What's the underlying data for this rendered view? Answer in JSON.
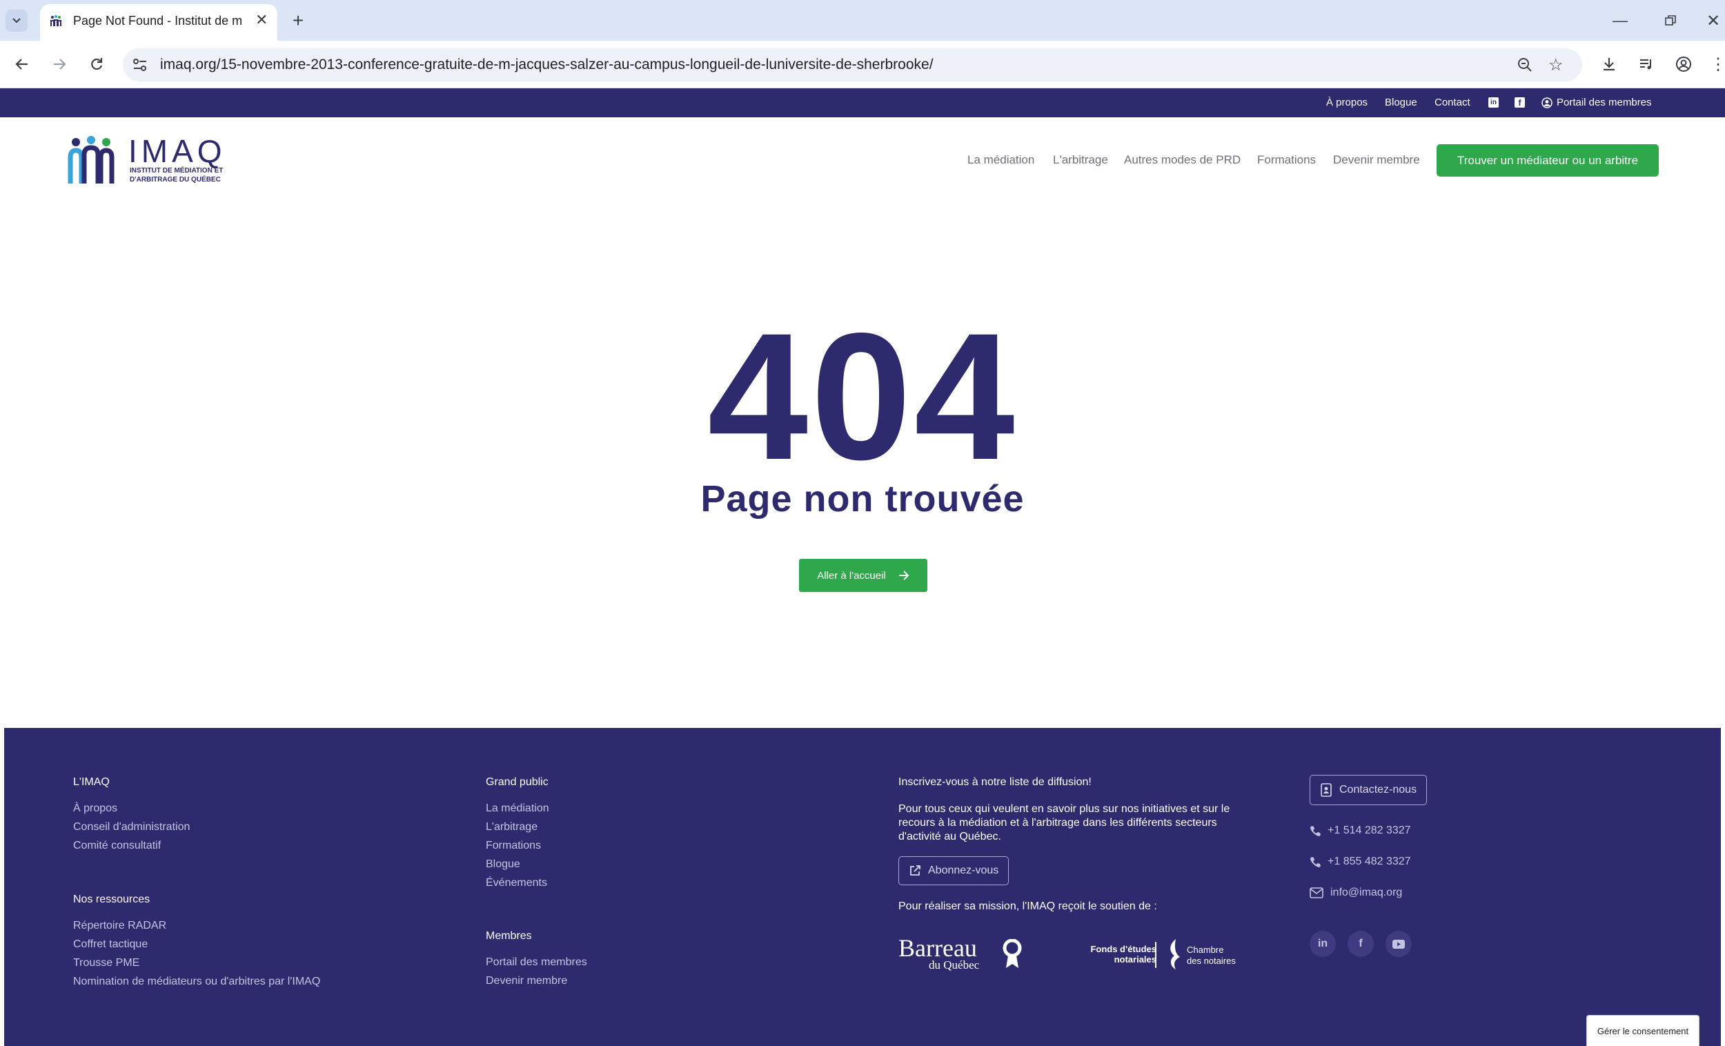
{
  "browser": {
    "tab_title": "Page Not Found - Institut de m",
    "url": "imaq.org/15-novembre-2013-conference-gratuite-de-m-jacques-salzer-au-campus-longueil-de-luniversite-de-sherbrooke/"
  },
  "topbar": {
    "links": [
      "À propos",
      "Blogue",
      "Contact"
    ],
    "members_portal": "Portail des membres"
  },
  "header": {
    "logo_text": "IMAQ",
    "logo_sub_line1": "INSTITUT DE MÉDIATION ET",
    "logo_sub_line2": "D'ARBITRAGE DU QUÉBEC",
    "nav": [
      "La médiation",
      "L'arbitrage",
      "Autres modes de PRD",
      "Formations",
      "Devenir membre"
    ],
    "cta": "Trouver un médiateur ou un arbitre"
  },
  "main": {
    "code": "404",
    "title": "Page non trouvée",
    "home_button": "Aller à l'accueil"
  },
  "footer": {
    "col1": {
      "heading": "L'IMAQ",
      "links": [
        "À propos",
        "Conseil d'administration",
        "Comité consultatif"
      ],
      "heading2": "Nos ressources",
      "links2": [
        "Répertoire RADAR",
        "Coffret tactique",
        "Trousse PME",
        "Nomination de médiateurs ou d'arbitres par l'IMAQ"
      ]
    },
    "col2": {
      "heading": "Grand public",
      "links": [
        "La médiation",
        "L'arbitrage",
        "Formations",
        "Blogue",
        "Événements"
      ],
      "heading2": "Membres",
      "links2": [
        "Portail des membres",
        "Devenir membre"
      ]
    },
    "col3": {
      "heading": "Inscrivez-vous à notre liste de diffusion!",
      "text": "Pour tous ceux qui veulent en savoir plus sur nos initiatives et sur le recours à la médiation et à l'arbitrage dans les différents secteurs d'activité au Québec.",
      "subscribe": "Abonnez-vous",
      "support": "Pour réaliser sa mission, l'IMAQ reçoit le soutien de :",
      "sponsor1": "Barreau",
      "sponsor1_sub": "du Québec",
      "sponsor2_line1": "Fonds d'études",
      "sponsor2_line2": "notariales",
      "sponsor3_line1": "Chambre",
      "sponsor3_line2": "des notaires"
    },
    "col4": {
      "contact_button": "Contactez-nous",
      "phone1": "+1 514 282 3327",
      "phone2": "+1 855 482 3327",
      "email": "info@imaq.org",
      "social": [
        "linkedin-icon",
        "facebook-icon",
        "youtube-icon"
      ]
    }
  },
  "consent": "Gérer le consentement",
  "colors": {
    "brand": "#2e2a6e",
    "accent": "#2ea84a"
  }
}
